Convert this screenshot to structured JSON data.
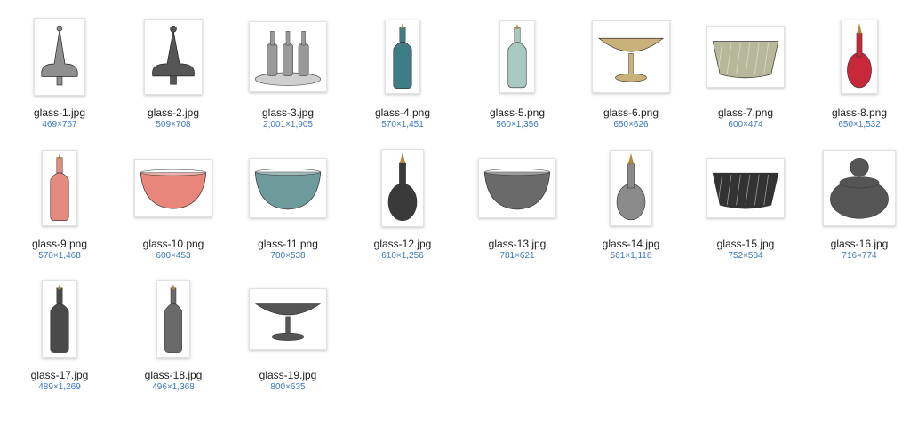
{
  "files": [
    {
      "name": "glass-1.jpg",
      "dims": "469×767",
      "icon": "stopper-icon",
      "color": "#8f8f8f"
    },
    {
      "name": "glass-2.jpg",
      "dims": "509×708",
      "icon": "stopper-icon",
      "color": "#555555"
    },
    {
      "name": "glass-3.jpg",
      "dims": "2,001×1,905",
      "icon": "cruet-set-icon",
      "color": "#9a9a9a"
    },
    {
      "name": "glass-4.png",
      "dims": "570×1,451",
      "icon": "bottle-icon",
      "color": "#3e7d85"
    },
    {
      "name": "glass-5.png",
      "dims": "560×1,356",
      "icon": "bottle-icon",
      "color": "#a9c9c0"
    },
    {
      "name": "glass-6.png",
      "dims": "650×626",
      "icon": "compote-icon",
      "color": "#c9b27a"
    },
    {
      "name": "glass-7.png",
      "dims": "600×474",
      "icon": "basket-bowl-icon",
      "color": "#b7b79a"
    },
    {
      "name": "glass-8.png",
      "dims": "650×1,532",
      "icon": "decanter-icon",
      "color": "#c8283a"
    },
    {
      "name": "glass-9.png",
      "dims": "570×1,468",
      "icon": "bottle-icon",
      "color": "#e58a7e"
    },
    {
      "name": "glass-10.png",
      "dims": "600×453",
      "icon": "bowl-icon",
      "color": "#e9867b"
    },
    {
      "name": "glass-11.png",
      "dims": "700×538",
      "icon": "bowl-icon",
      "color": "#6d9a9a"
    },
    {
      "name": "glass-12.jpg",
      "dims": "610×1,256",
      "icon": "decanter-icon",
      "color": "#3a3a3a"
    },
    {
      "name": "glass-13.jpg",
      "dims": "781×621",
      "icon": "bowl-icon",
      "color": "#6a6a6a"
    },
    {
      "name": "glass-14.jpg",
      "dims": "561×1,118",
      "icon": "decanter-icon",
      "color": "#8a8a8a"
    },
    {
      "name": "glass-15.jpg",
      "dims": "752×584",
      "icon": "basket-bowl-icon",
      "color": "#333333"
    },
    {
      "name": "glass-16.jpg",
      "dims": "716×774",
      "icon": "covered-jar-icon",
      "color": "#555555"
    },
    {
      "name": "glass-17.jpg",
      "dims": "489×1,269",
      "icon": "bottle-icon",
      "color": "#4a4a4a"
    },
    {
      "name": "glass-18.jpg",
      "dims": "496×1,368",
      "icon": "bottle-icon",
      "color": "#6a6a6a"
    },
    {
      "name": "glass-19.jpg",
      "dims": "800×635",
      "icon": "compote-icon",
      "color": "#555555"
    }
  ]
}
